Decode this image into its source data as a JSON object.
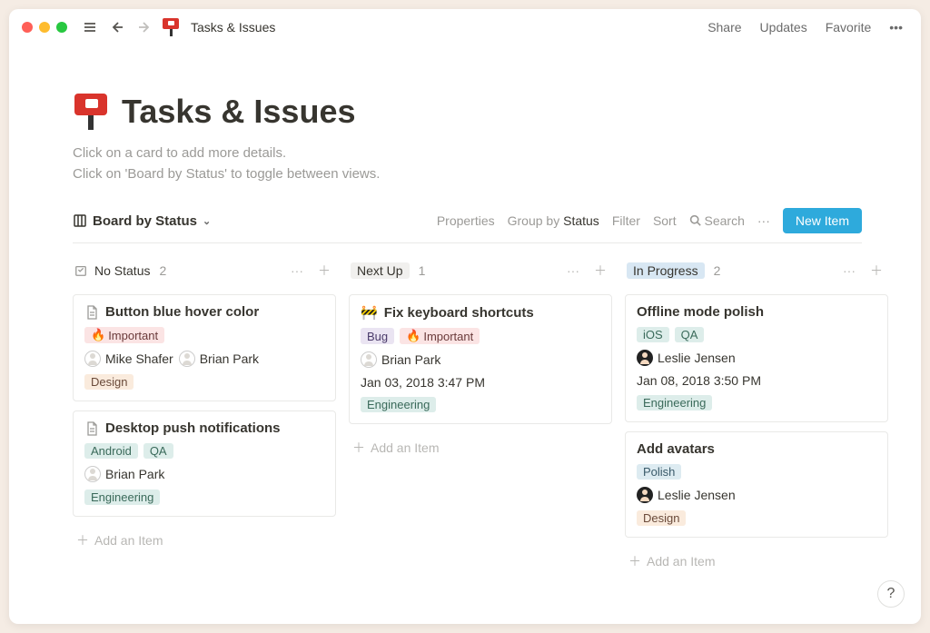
{
  "titlebar": {
    "title": "Tasks & Issues"
  },
  "topbar": {
    "share": "Share",
    "updates": "Updates",
    "favorite": "Favorite"
  },
  "page": {
    "title": "Tasks & Issues",
    "desc_line1": "Click on a card to add more details.",
    "desc_line2": "Click on 'Board by Status' to toggle between views."
  },
  "viewbar": {
    "view_name": "Board by Status",
    "properties": "Properties",
    "group_prefix": "Group by ",
    "group_value": "Status",
    "filter": "Filter",
    "sort": "Sort",
    "search": "Search",
    "more": "···",
    "new_item": "New Item"
  },
  "columns": [
    {
      "name": "No Status",
      "count": "2",
      "chip": false
    },
    {
      "name": "Next Up",
      "count": "1",
      "chip": true
    },
    {
      "name": "In Progress",
      "count": "2",
      "chip": true,
      "blue": true
    }
  ],
  "cards": {
    "c0": {
      "title": "Button blue hover color",
      "tags_top": [
        {
          "emoji": "🔥",
          "text": "Important",
          "color": "red"
        }
      ],
      "people": [
        {
          "name": "Mike Shafer"
        },
        {
          "name": "Brian Park"
        }
      ],
      "tags_bottom": [
        {
          "text": "Design",
          "color": "orange"
        }
      ]
    },
    "c1": {
      "title": "Desktop push notifications",
      "tags_top": [
        {
          "text": "Android",
          "color": "green"
        },
        {
          "text": "QA",
          "color": "green"
        }
      ],
      "people": [
        {
          "name": "Brian Park"
        }
      ],
      "tags_bottom": [
        {
          "text": "Engineering",
          "color": "green"
        }
      ]
    },
    "c2": {
      "title": "Fix keyboard shortcuts",
      "title_emoji": "🚧",
      "tags_top": [
        {
          "text": "Bug",
          "color": "purple"
        },
        {
          "emoji": "🔥",
          "text": "Important",
          "color": "red"
        }
      ],
      "people": [
        {
          "name": "Brian Park"
        }
      ],
      "timestamp": "Jan 03, 2018 3:47 PM",
      "tags_bottom": [
        {
          "text": "Engineering",
          "color": "green"
        }
      ]
    },
    "c3": {
      "title": "Offline mode polish",
      "tags_top": [
        {
          "text": "iOS",
          "color": "green"
        },
        {
          "text": "QA",
          "color": "green"
        }
      ],
      "people": [
        {
          "name": "Leslie Jensen",
          "dark": true
        }
      ],
      "timestamp": "Jan 08, 2018 3:50 PM",
      "tags_bottom": [
        {
          "text": "Engineering",
          "color": "green"
        }
      ]
    },
    "c4": {
      "title": "Add avatars",
      "tags_top": [
        {
          "text": "Polish",
          "color": "blue"
        }
      ],
      "people": [
        {
          "name": "Leslie Jensen",
          "dark": true
        }
      ],
      "tags_bottom": [
        {
          "text": "Design",
          "color": "orange"
        }
      ]
    }
  },
  "add_item": "Add an Item"
}
